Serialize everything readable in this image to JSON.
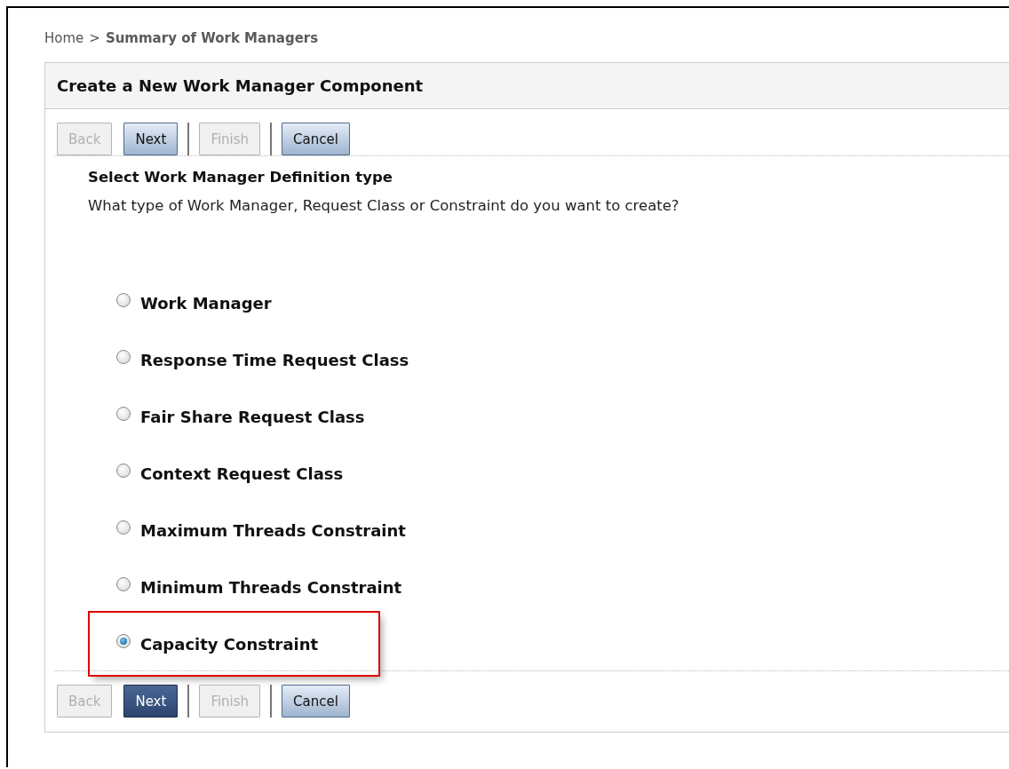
{
  "breadcrumb": {
    "items": [
      {
        "label": "Home",
        "current": false
      },
      {
        "label": "Summary of Work Managers",
        "current": true
      }
    ],
    "separator": ">"
  },
  "panel": {
    "title": "Create a New Work Manager Component"
  },
  "toolbar_top": [
    [
      {
        "label": "Back",
        "disabled": true,
        "focused": false
      },
      {
        "label": "Next",
        "disabled": false,
        "focused": false
      }
    ],
    [
      {
        "label": "Finish",
        "disabled": true,
        "focused": false
      }
    ],
    [
      {
        "label": "Cancel",
        "disabled": false,
        "focused": false
      }
    ]
  ],
  "section": {
    "heading": "Select Work Manager Definition type",
    "description": "What type of Work Manager, Request Class or Constraint do you want to create?"
  },
  "options": [
    {
      "label": "Work Manager",
      "selected": false,
      "highlighted": false
    },
    {
      "label": "Response Time Request Class",
      "selected": false,
      "highlighted": false
    },
    {
      "label": "Fair Share Request Class",
      "selected": false,
      "highlighted": false
    },
    {
      "label": "Context Request Class",
      "selected": false,
      "highlighted": false
    },
    {
      "label": "Maximum Threads Constraint",
      "selected": false,
      "highlighted": false
    },
    {
      "label": "Minimum Threads Constraint",
      "selected": false,
      "highlighted": false
    },
    {
      "label": "Capacity Constraint",
      "selected": true,
      "highlighted": true
    }
  ],
  "toolbar_bottom": [
    [
      {
        "label": "Back",
        "disabled": true,
        "focused": false
      },
      {
        "label": "Next",
        "disabled": false,
        "focused": true
      }
    ],
    [
      {
        "label": "Finish",
        "disabled": true,
        "focused": false
      }
    ],
    [
      {
        "label": "Cancel",
        "disabled": false,
        "focused": false
      }
    ]
  ]
}
